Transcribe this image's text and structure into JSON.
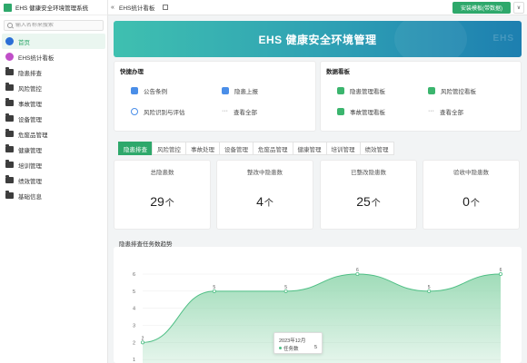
{
  "app": {
    "title": "EHS 健康安全环境管理系统"
  },
  "search": {
    "placeholder": "输入名称来搜索"
  },
  "sidebar": {
    "items": [
      {
        "label": "首页",
        "icon": "home-icon",
        "active": true
      },
      {
        "label": "EHS统计看板",
        "icon": "dashboard-icon",
        "active": false
      },
      {
        "label": "隐患排查",
        "icon": "folder-icon",
        "active": false
      },
      {
        "label": "风险管控",
        "icon": "folder-icon",
        "active": false
      },
      {
        "label": "事故管理",
        "icon": "folder-icon",
        "active": false
      },
      {
        "label": "设备管理",
        "icon": "folder-icon",
        "active": false
      },
      {
        "label": "危废品管理",
        "icon": "folder-icon",
        "active": false
      },
      {
        "label": "健康管理",
        "icon": "folder-icon",
        "active": false
      },
      {
        "label": "培训管理",
        "icon": "folder-icon",
        "active": false
      },
      {
        "label": "绩效管理",
        "icon": "folder-icon",
        "active": false
      },
      {
        "label": "基础信息",
        "icon": "folder-icon",
        "active": false
      }
    ]
  },
  "topbar": {
    "collapse": "«",
    "tab_title": "EHS统计看板",
    "install_button": "安装模板(带数据)",
    "more_button": "∨"
  },
  "banner": {
    "title": "EHS 健康安全环境管理",
    "watermark": "EHS"
  },
  "quick": {
    "title": "快捷办理",
    "items": [
      "公告条例",
      "隐患上报",
      "风险识别与评估",
      "查看全部"
    ]
  },
  "boards": {
    "title": "数据看板",
    "items": [
      "隐患管理看板",
      "风险管控看板",
      "事故管理看板",
      "查看全部"
    ]
  },
  "tabs": [
    "隐患排查",
    "风险管控",
    "事故处理",
    "设备管理",
    "危废品管理",
    "健康管理",
    "培训管理",
    "绩效管理"
  ],
  "stats": [
    {
      "label": "总隐患数",
      "value": "29",
      "unit": "个"
    },
    {
      "label": "整改中隐患数",
      "value": "4",
      "unit": "个"
    },
    {
      "label": "已整改隐患数",
      "value": "25",
      "unit": "个"
    },
    {
      "label": "验收中隐患数",
      "value": "0",
      "unit": "个"
    }
  ],
  "colors": {
    "accent": "#2ea86b",
    "area_fill": "#9bdab5",
    "line": "#4fbf85"
  },
  "chart_data": {
    "type": "area",
    "title": "隐患排查任务数趋势",
    "xlabel": "",
    "ylabel": "",
    "ylim": [
      0,
      6
    ],
    "yticks": [
      0,
      1,
      2,
      3,
      4,
      5,
      6
    ],
    "grid": true,
    "series": [
      {
        "name": "任务数",
        "values": [
          2,
          5,
          5,
          6,
          5,
          6
        ]
      }
    ],
    "tooltip": {
      "title": "2023年12月",
      "name": "任务数",
      "value": "5"
    }
  }
}
